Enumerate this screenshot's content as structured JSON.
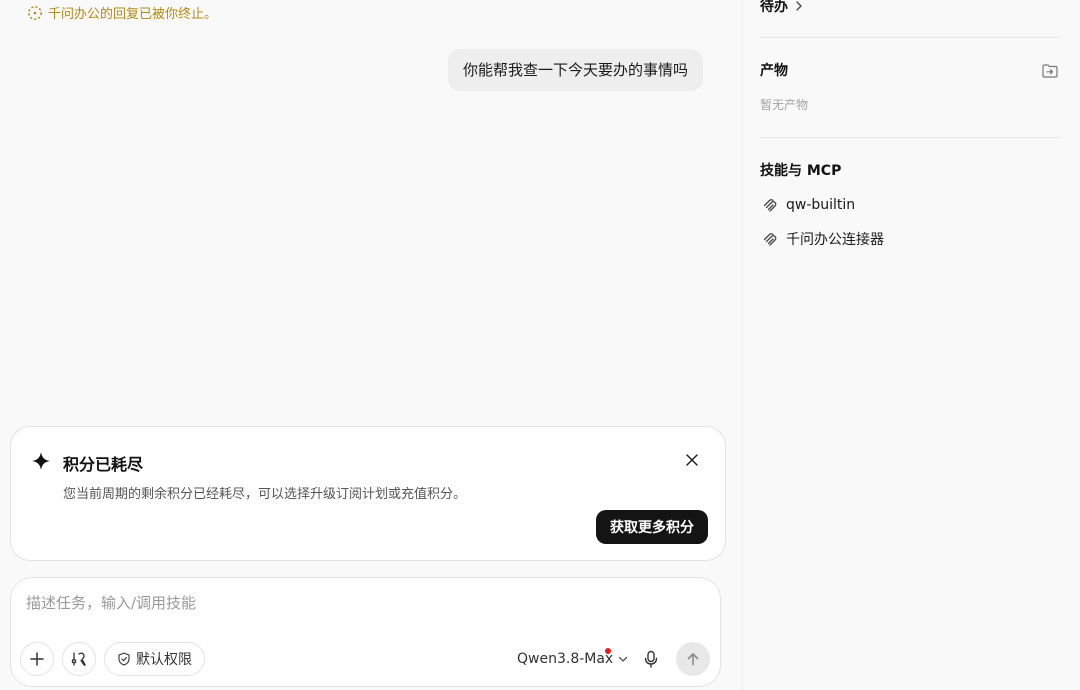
{
  "chat": {
    "stopped_note": "千问办公的回复已被你终止。",
    "user_message": "你能帮我查一下今天要办的事情吗"
  },
  "credits_card": {
    "title": "积分已耗尽",
    "description": "您当前周期的剩余积分已经耗尽，可以选择升级订阅计划或充值积分。",
    "button_label": "获取更多积分"
  },
  "composer": {
    "placeholder": "描述任务，输入/调用技能",
    "value": "",
    "permission_label": "默认权限",
    "model_label": "Qwen3.8-Max",
    "model_has_notice": true
  },
  "side_panel": {
    "todo_label": "待办",
    "artifacts_title": "产物",
    "artifacts_empty": "暂无产物",
    "skills_title": "技能与 MCP",
    "skills": [
      {
        "label": "qw-builtin",
        "icon": "plugin-icon"
      },
      {
        "label": "千问办公连接器",
        "icon": "plugin-icon"
      }
    ]
  },
  "colors": {
    "accent_dark": "#141414",
    "note_gold": "#b48a12",
    "notice_dot": "#e02020"
  }
}
